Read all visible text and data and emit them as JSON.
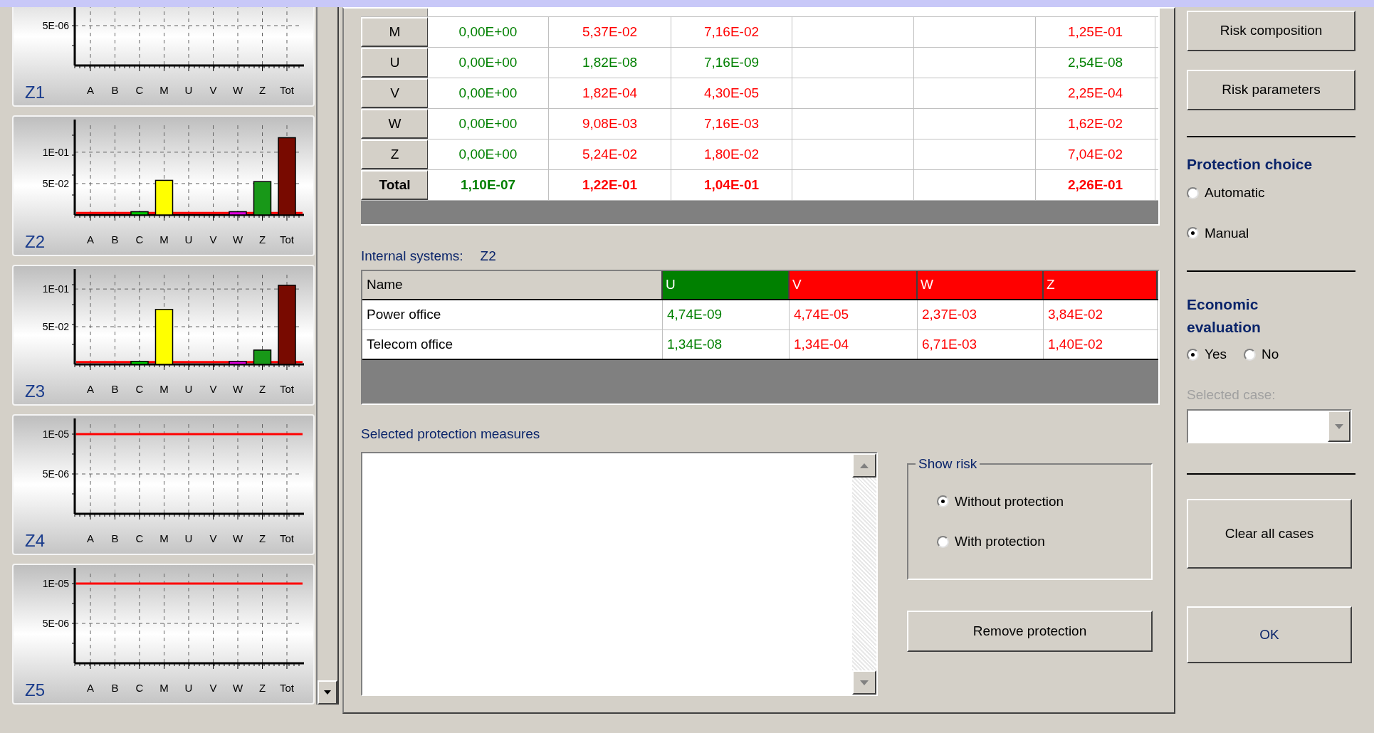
{
  "charts_panel": {
    "charts": [
      {
        "label": "Z1",
        "categories": [
          "A",
          "B",
          "C",
          "M",
          "U",
          "V",
          "W",
          "Z",
          "Tot"
        ],
        "y_tick_label": "5E-06"
      },
      {
        "label": "Z2",
        "chart_data": {
          "type": "bar",
          "categories": [
            "A",
            "B",
            "C",
            "M",
            "U",
            "V",
            "W",
            "Z",
            "Tot"
          ],
          "ylim": [
            0,
            0.143
          ],
          "yticks": [
            {
              "value": 0.05,
              "label": "5E-02"
            },
            {
              "value": 0.1,
              "label": "1E-01"
            }
          ],
          "grid": true,
          "series": [
            {
              "color": "#00c800",
              "values": [
                null,
                null,
                0.004,
                null,
                null,
                null,
                null,
                null,
                null
              ]
            },
            {
              "color": "#ffff00",
              "values": [
                null,
                null,
                null,
                0.054,
                null,
                null,
                null,
                null,
                null
              ]
            },
            {
              "color": "#e000e0",
              "values": [
                null,
                null,
                null,
                null,
                null,
                null,
                0.004,
                null,
                null
              ]
            },
            {
              "color": "#189818",
              "values": [
                null,
                null,
                null,
                null,
                null,
                null,
                null,
                0.052,
                null
              ]
            },
            {
              "color": "#780a00",
              "values": [
                null,
                null,
                null,
                null,
                null,
                null,
                null,
                null,
                0.122
              ]
            }
          ],
          "ref_lines": [
            {
              "axis": "y",
              "value": 0.003,
              "color": "#ff0000"
            }
          ]
        }
      },
      {
        "label": "Z3",
        "chart_data": {
          "type": "bar",
          "categories": [
            "A",
            "B",
            "C",
            "M",
            "U",
            "V",
            "W",
            "Z",
            "Tot"
          ],
          "ylim": [
            0,
            0.119
          ],
          "yticks": [
            {
              "value": 0.05,
              "label": "5E-02"
            },
            {
              "value": 0.1,
              "label": "1E-01"
            }
          ],
          "grid": true,
          "series": [
            {
              "color": "#00c800",
              "values": [
                null,
                null,
                0.003,
                null,
                null,
                null,
                null,
                null,
                null
              ]
            },
            {
              "color": "#ffff00",
              "values": [
                null,
                null,
                null,
                0.072,
                null,
                null,
                null,
                null,
                null
              ]
            },
            {
              "color": "#e000e0",
              "values": [
                null,
                null,
                null,
                null,
                null,
                null,
                0.003,
                null,
                null
              ]
            },
            {
              "color": "#189818",
              "values": [
                null,
                null,
                null,
                null,
                null,
                null,
                null,
                0.018,
                null
              ]
            },
            {
              "color": "#780a00",
              "values": [
                null,
                null,
                null,
                null,
                null,
                null,
                null,
                null,
                0.104
              ]
            }
          ],
          "ref_lines": [
            {
              "axis": "y",
              "value": 0.003,
              "color": "#ff0000"
            }
          ]
        }
      },
      {
        "label": "Z4",
        "chart_data": {
          "type": "bar",
          "categories": [
            "A",
            "B",
            "C",
            "M",
            "U",
            "V",
            "W",
            "Z",
            "Tot"
          ],
          "ylim": [
            0,
            1.125e-05
          ],
          "yticks": [
            {
              "value": 5e-06,
              "label": "5E-06"
            },
            {
              "value": 1e-05,
              "label": "1E-05"
            }
          ],
          "grid": true,
          "ref_lines": [
            {
              "axis": "y",
              "value": 1e-05,
              "color": "#ff0000"
            }
          ]
        }
      },
      {
        "label": "Z5",
        "chart_data": {
          "type": "bar",
          "categories": [
            "A",
            "B",
            "C",
            "M",
            "U",
            "V",
            "W",
            "Z",
            "Tot"
          ],
          "ylim": [
            0,
            1.125e-05
          ],
          "yticks": [
            {
              "value": 5e-06,
              "label": "5E-06"
            },
            {
              "value": 1e-05,
              "label": "1E-05"
            }
          ],
          "grid": true,
          "ref_lines": [
            {
              "axis": "y",
              "value": 1e-05,
              "color": "#ff0000"
            }
          ]
        }
      }
    ]
  },
  "risk_table": {
    "rows": [
      {
        "label": "M",
        "kind": "normal",
        "cells": [
          {
            "text": "0,00E+00",
            "tolerable": true
          },
          {
            "text": "5,37E-02",
            "tolerable": false
          },
          {
            "text": "7,16E-02",
            "tolerable": false
          },
          null,
          null,
          {
            "text": "1,25E-01",
            "tolerable": false
          }
        ]
      },
      {
        "label": "U",
        "kind": "normal",
        "cells": [
          {
            "text": "0,00E+00",
            "tolerable": true
          },
          {
            "text": "1,82E-08",
            "tolerable": true
          },
          {
            "text": "7,16E-09",
            "tolerable": true
          },
          null,
          null,
          {
            "text": "2,54E-08",
            "tolerable": true
          }
        ]
      },
      {
        "label": "V",
        "kind": "normal",
        "cells": [
          {
            "text": "0,00E+00",
            "tolerable": true
          },
          {
            "text": "1,82E-04",
            "tolerable": false
          },
          {
            "text": "4,30E-05",
            "tolerable": false
          },
          null,
          null,
          {
            "text": "2,25E-04",
            "tolerable": false
          }
        ]
      },
      {
        "label": "W",
        "kind": "normal",
        "cells": [
          {
            "text": "0,00E+00",
            "tolerable": true
          },
          {
            "text": "9,08E-03",
            "tolerable": false
          },
          {
            "text": "7,16E-03",
            "tolerable": false
          },
          null,
          null,
          {
            "text": "1,62E-02",
            "tolerable": false
          }
        ]
      },
      {
        "label": "Z",
        "kind": "normal",
        "cells": [
          {
            "text": "0,00E+00",
            "tolerable": true
          },
          {
            "text": "5,24E-02",
            "tolerable": false
          },
          {
            "text": "1,80E-02",
            "tolerable": false
          },
          null,
          null,
          {
            "text": "7,04E-02",
            "tolerable": false
          }
        ]
      },
      {
        "label": "Total",
        "kind": "total",
        "cells": [
          {
            "text": "1,10E-07",
            "tolerable": true
          },
          {
            "text": "1,22E-01",
            "tolerable": false
          },
          {
            "text": "1,04E-01",
            "tolerable": false
          },
          null,
          null,
          {
            "text": "2,26E-01",
            "tolerable": false
          }
        ]
      }
    ]
  },
  "internal_systems": {
    "label": "Internal systems:",
    "zone": "Z2",
    "name_header": "Name",
    "columns": [
      {
        "text": "U",
        "tolerable": true
      },
      {
        "text": "V",
        "tolerable": false
      },
      {
        "text": "W",
        "tolerable": false
      },
      {
        "text": "Z",
        "tolerable": false
      }
    ],
    "rows": [
      {
        "name": "Power office",
        "cells": [
          {
            "text": "4,74E-09",
            "tolerable": true
          },
          {
            "text": "4,74E-05",
            "tolerable": false
          },
          {
            "text": "2,37E-03",
            "tolerable": false
          },
          {
            "text": "3,84E-02",
            "tolerable": false
          }
        ]
      },
      {
        "name": "Telecom office",
        "cells": [
          {
            "text": "1,34E-08",
            "tolerable": true
          },
          {
            "text": "1,34E-04",
            "tolerable": false
          },
          {
            "text": "6,71E-03",
            "tolerable": false
          },
          {
            "text": "1,40E-02",
            "tolerable": false
          }
        ]
      }
    ]
  },
  "protection_measures": {
    "label": "Selected protection measures"
  },
  "show_risk": {
    "title": "Show risk",
    "options": [
      {
        "label": "Without protection",
        "selected": true
      },
      {
        "label": "With protection",
        "selected": false
      }
    ]
  },
  "remove_button": "Remove protection",
  "side": {
    "buttons": [
      "Risk composition",
      "Risk parameters"
    ],
    "protection_choice": {
      "title": "Protection choice",
      "options": [
        {
          "label": "Automatic",
          "selected": false
        },
        {
          "label": "Manual",
          "selected": true
        }
      ]
    },
    "economic_evaluation": {
      "title": "Economic evaluation",
      "options": [
        {
          "label": "Yes",
          "selected": true
        },
        {
          "label": "No",
          "selected": false
        }
      ]
    },
    "selected_case": {
      "label": "Selected case:",
      "disabled": true
    },
    "clear_button": "Clear all cases",
    "ok_button": "OK"
  }
}
